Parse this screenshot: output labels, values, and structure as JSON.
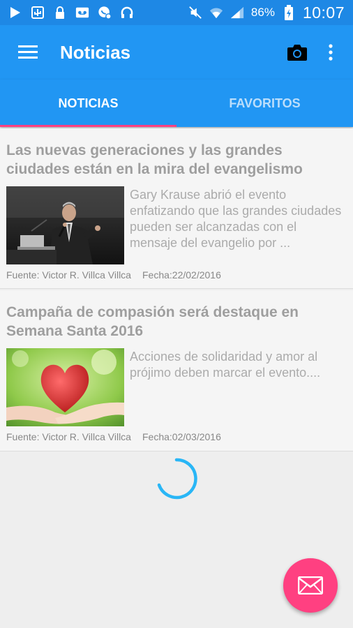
{
  "status_bar": {
    "battery_percent": "86%",
    "time": "10:07"
  },
  "app_bar": {
    "title": "Noticias"
  },
  "tabs": [
    {
      "label": "NOTICIAS",
      "active": true
    },
    {
      "label": "FAVORITOS",
      "active": false
    }
  ],
  "news": [
    {
      "title": "Las nuevas generaciones y las grandes ciudades están en la mira del evangelismo",
      "description": "Gary Krause abrió el evento enfatizando que las grandes ciudades pueden ser alcanzadas con el mensaje del evangelio por ...",
      "source": "Fuente: Victor R. Villca Villca",
      "date": "Fecha:22/02/2016",
      "image": "speaker-at-podium-photo"
    },
    {
      "title": "Campaña de compasión será destaque en Semana Santa 2016",
      "description": "Acciones de solidaridad y amor al prójimo deben marcar el evento....",
      "source": "Fuente: Victor R. Villca Villca",
      "date": "Fecha:02/03/2016",
      "image": "hands-holding-heart-photo"
    }
  ],
  "colors": {
    "primary": "#2196f3",
    "primary_dark": "#1e88e5",
    "accent": "#ff4081",
    "spinner": "#29b6f6"
  },
  "fab": {
    "icon": "mail-icon"
  }
}
